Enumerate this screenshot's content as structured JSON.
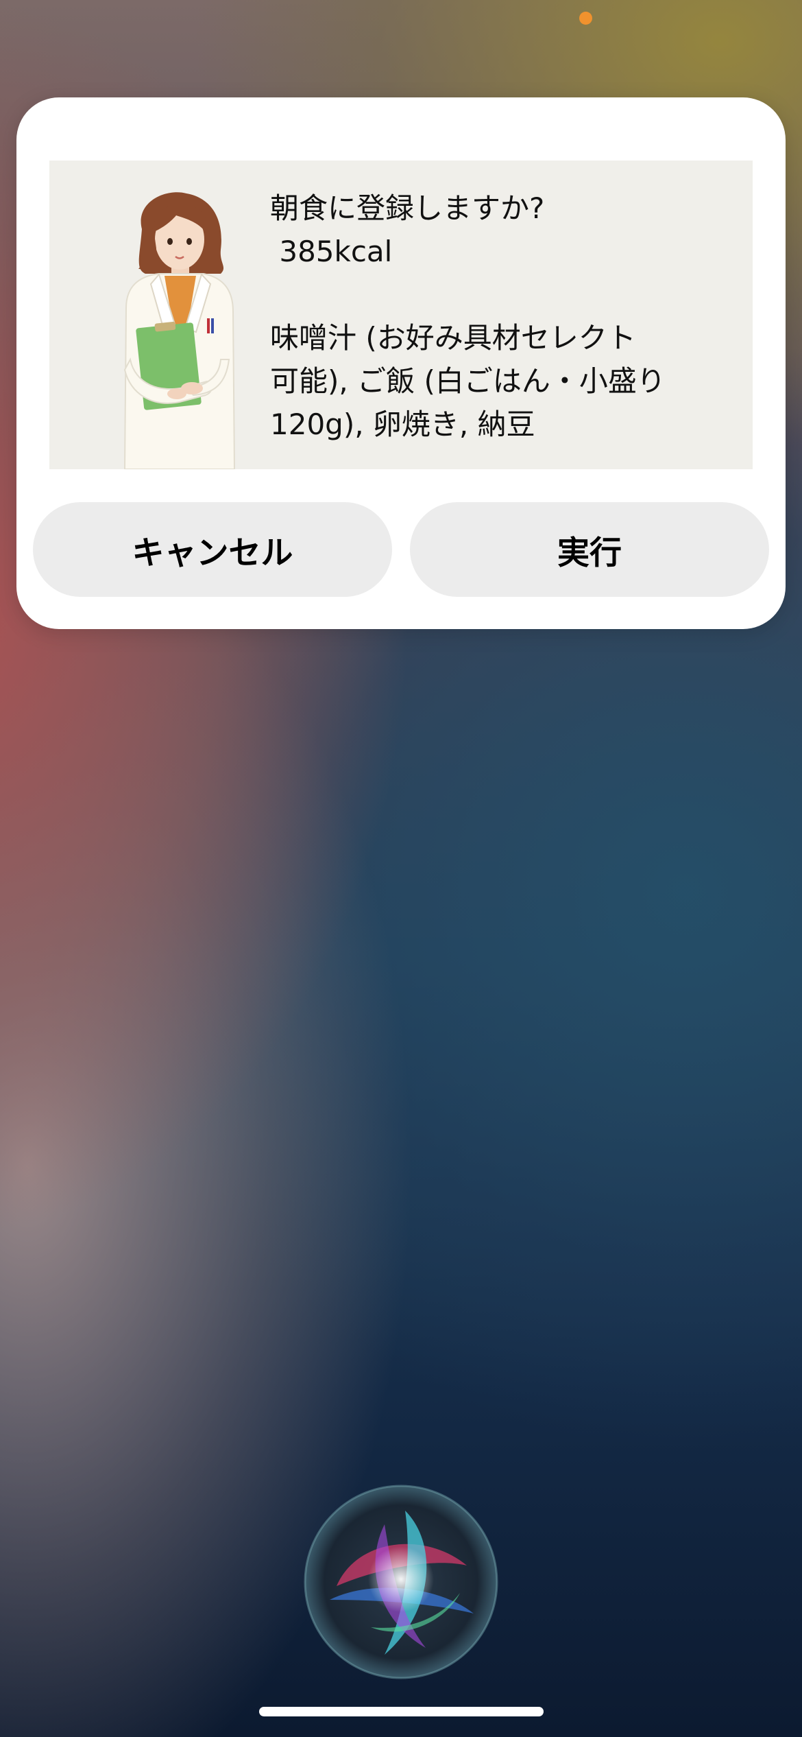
{
  "dialog": {
    "question": "朝食に登録しますか?",
    "calories": " 385kcal",
    "menu_line_1": "味噌汁 (お好み具材セレクト",
    "menu_line_2": "可能), ご飯 (白ごはん・小盛り",
    "menu_line_3": "120g), 卵焼き, 納豆"
  },
  "buttons": {
    "cancel_label": "キャンセル",
    "run_label": "実行"
  },
  "icons": {
    "avatar": "nutritionist-illustration",
    "assistant": "siri-orb"
  },
  "colors": {
    "card_background": "#ffffff",
    "panel_background": "#f0efea",
    "button_background": "#ececec",
    "camera_indicator": "#f0922e"
  }
}
